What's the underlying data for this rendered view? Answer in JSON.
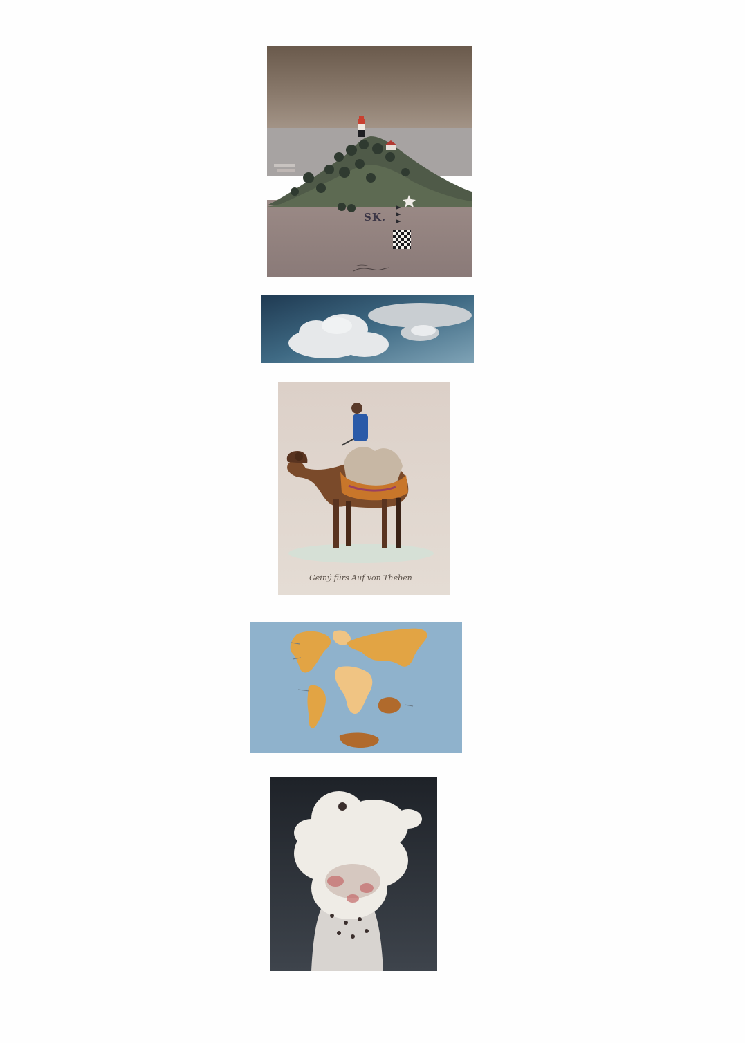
{
  "page": {
    "background": "#fefefe"
  },
  "cards": [
    {
      "id": "lighthouse-painting",
      "label_text": "SK."
    },
    {
      "id": "clouds-photo"
    },
    {
      "id": "camel-painting",
      "caption": "Geiný fürs Auf von Theben"
    },
    {
      "id": "world-map-cutout"
    },
    {
      "id": "porcelain-sculpture"
    }
  ]
}
